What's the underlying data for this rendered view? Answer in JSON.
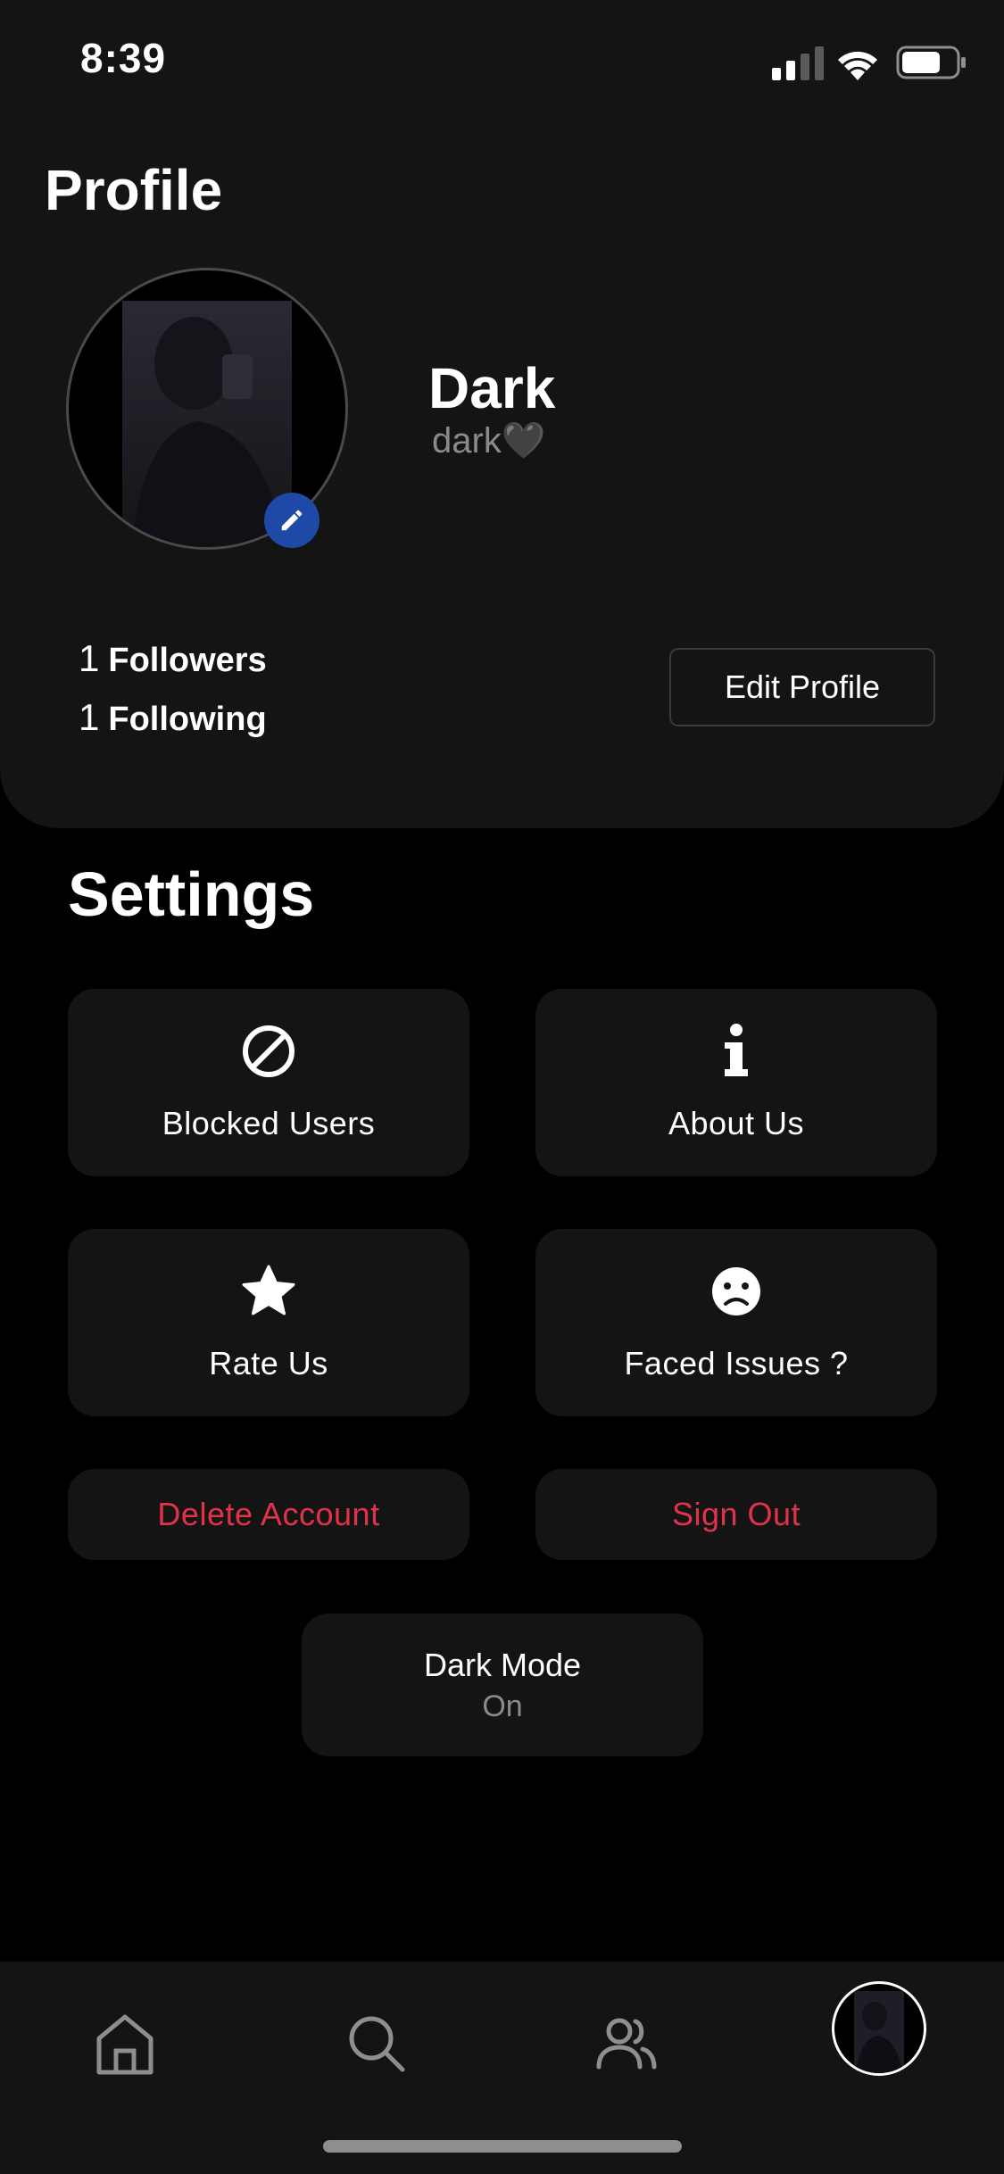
{
  "status_bar": {
    "time": "8:39"
  },
  "profile": {
    "title": "Profile",
    "name": "Dark",
    "handle": "dark🖤",
    "followers_count": "1",
    "followers_label": "Followers",
    "following_count": "1",
    "following_label": "Following",
    "edit_profile_label": "Edit Profile"
  },
  "settings": {
    "title": "Settings",
    "tiles": [
      {
        "label": "Blocked Users",
        "icon": "block-icon"
      },
      {
        "label": "About Us",
        "icon": "info-icon"
      },
      {
        "label": "Rate Us",
        "icon": "star-icon"
      },
      {
        "label": "Faced Issues ?",
        "icon": "sad-face-icon"
      }
    ],
    "delete_account_label": "Delete Account",
    "sign_out_label": "Sign Out",
    "dark_mode_label": "Dark Mode",
    "dark_mode_state": "On",
    "danger_color": "#e0334b"
  },
  "tab_bar": {
    "tabs": [
      {
        "name": "home",
        "icon": "home-icon"
      },
      {
        "name": "search",
        "icon": "search-icon"
      },
      {
        "name": "people",
        "icon": "people-icon"
      },
      {
        "name": "profile",
        "icon": "avatar"
      }
    ]
  }
}
